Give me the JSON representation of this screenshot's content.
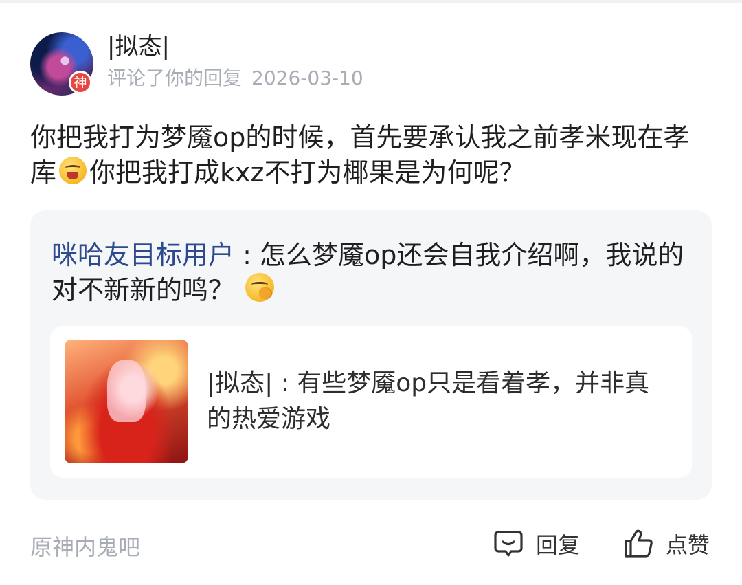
{
  "comment": {
    "author": {
      "name": "|拟态|",
      "badge": "神"
    },
    "action": "评论了你的回复",
    "date": "2026-03-10",
    "content": {
      "text_before_emoji": "你把我打为梦魇op的时候，首先要承认我之前孝米现在孝库",
      "emoji": "laughing-squint-emoji",
      "text_after_emoji": "你把我打成kxz不打为椰果是为何呢？"
    }
  },
  "quoted_reply": {
    "user": "咪哈友目标用户",
    "separator": " : ",
    "text": "怎么梦魇op还会自我介绍啊，我说的对不新新的鸣？",
    "emoji": "hand-over-mouth-emoji",
    "original_post": {
      "author": "|拟态|",
      "separator": " : ",
      "text": "有些梦魇op只是看着孝，并非真的热爱游戏",
      "thumbnail": "anime-girl-red-dress-image"
    }
  },
  "footer": {
    "forum_tag": "原神内鬼吧",
    "reply_label": "回复",
    "reply_icon": "comment-bubble-icon",
    "like_label": "点赞",
    "like_icon": "thumbs-up-icon"
  },
  "colors": {
    "username_link": "#2e4a8e",
    "meta_gray": "#a8adb5",
    "quote_bg": "#f5f6f8",
    "badge_red": "#e9463f"
  }
}
